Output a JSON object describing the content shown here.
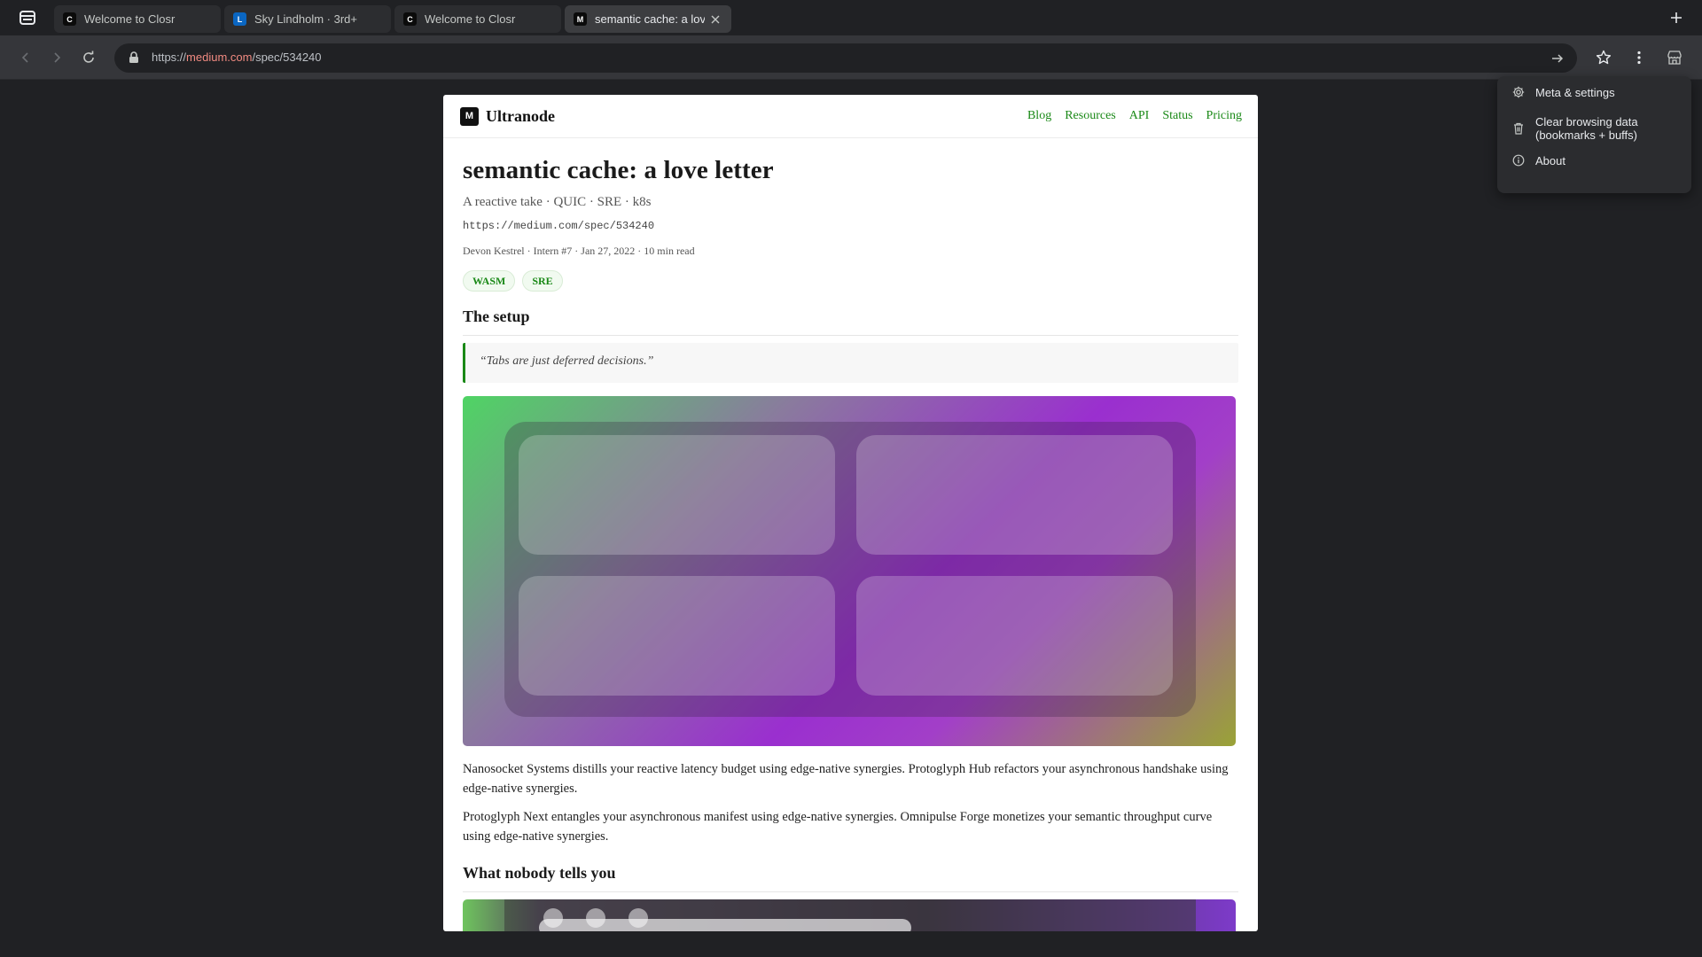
{
  "tabs": [
    {
      "favicon": "C",
      "title": "Welcome to Closr",
      "active": false
    },
    {
      "favicon": "L",
      "title": "Sky Lindholm · 3rd+",
      "active": false
    },
    {
      "favicon": "C",
      "title": "Welcome to Closr",
      "active": false
    },
    {
      "favicon": "M",
      "title": "semantic cache: a love l",
      "active": true
    }
  ],
  "omnibox": {
    "scheme": "https://",
    "host": "medium.com",
    "path": "/spec/534240"
  },
  "site": {
    "logo_letter": "M",
    "name": "Ultranode",
    "nav": [
      "Blog",
      "Resources",
      "API",
      "Status",
      "Pricing"
    ]
  },
  "article": {
    "title": "semantic cache: a love letter",
    "subtitle": "A reactive take · QUIC · SRE · k8s",
    "permalink": "https://medium.com/spec/534240",
    "byline": "Devon Kestrel · Intern #7 · Jan 27, 2022 · 10 min read",
    "tags": [
      "WASM",
      "SRE"
    ],
    "section1_heading": "The setup",
    "quote": "“Tabs are just deferred decisions.”",
    "paragraphs": [
      "Nanosocket Systems distills your reactive latency budget using edge-native synergies. Protoglyph Hub refactors your asynchronous handshake using edge-native synergies.",
      "Protoglyph Next entangles your asynchronous manifest using edge-native synergies. Omnipulse Forge monetizes your semantic throughput curve using edge-native synergies."
    ],
    "section2_heading": "What nobody tells you"
  },
  "menu": {
    "items": [
      {
        "icon": "gear-icon",
        "label": "Meta & settings"
      },
      {
        "icon": "trash-icon",
        "label": "Clear browsing data (bookmarks + buffs)"
      },
      {
        "icon": "info-icon",
        "label": "About"
      }
    ]
  },
  "colors": {
    "accent_green": "#1a8917",
    "url_host": "#f28b82",
    "browser_bg": "#202124"
  }
}
